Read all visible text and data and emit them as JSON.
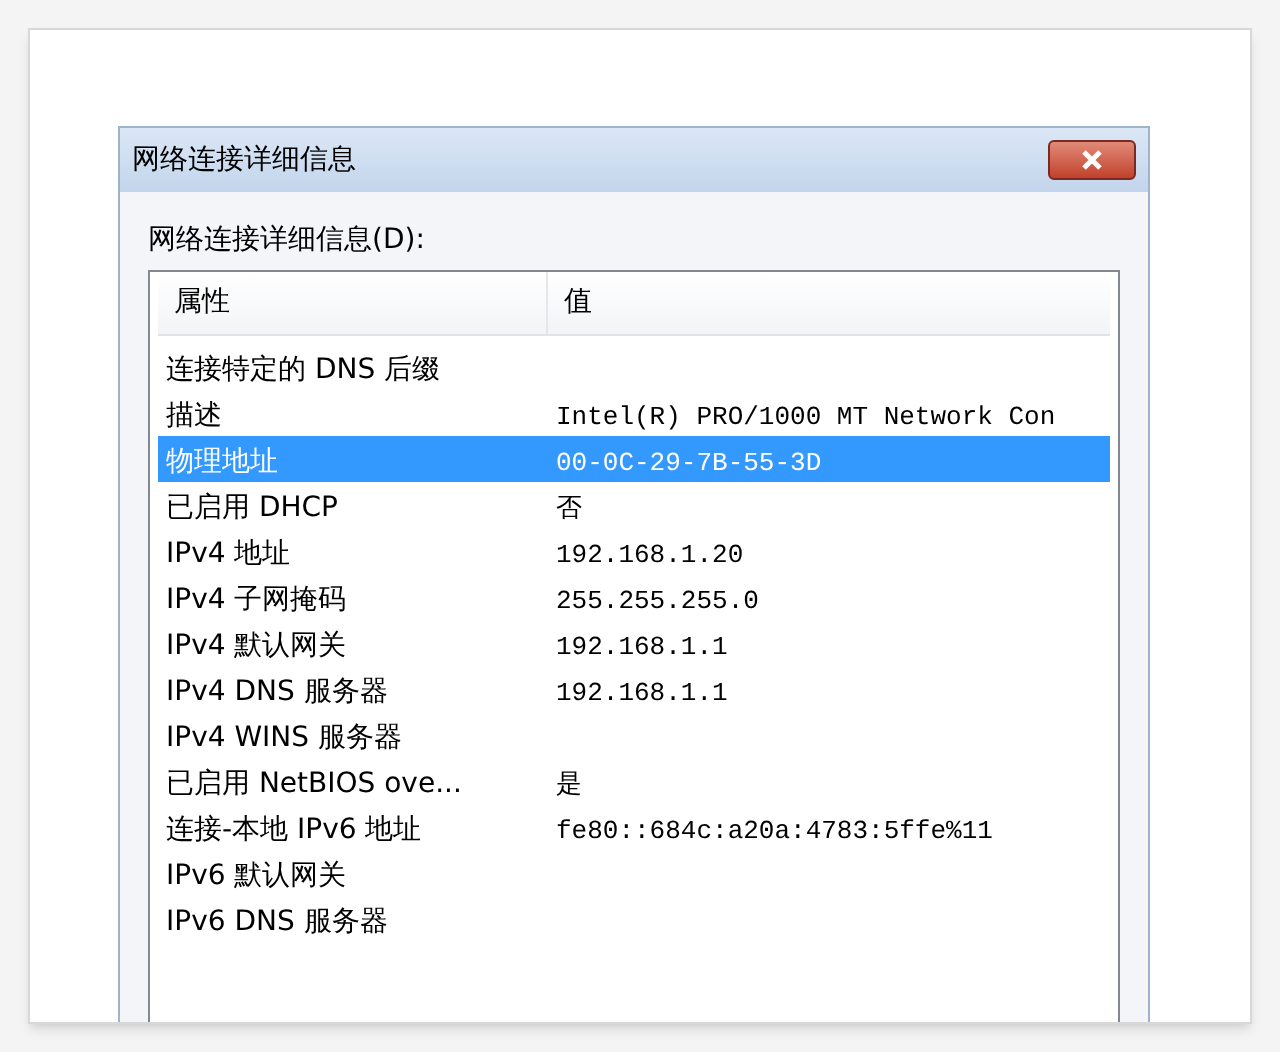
{
  "window": {
    "title": "网络连接详细信息"
  },
  "list_label": "网络连接详细信息(D):",
  "table": {
    "columns": [
      "属性",
      "值"
    ],
    "rows": [
      {
        "property": "连接特定的 DNS 后缀",
        "value": "",
        "selected": false
      },
      {
        "property": "描述",
        "value": "Intel(R) PRO/1000 MT Network Con",
        "selected": false
      },
      {
        "property": "物理地址",
        "value": "00-0C-29-7B-55-3D",
        "selected": true
      },
      {
        "property": "已启用 DHCP",
        "value": "否",
        "selected": false
      },
      {
        "property": "IPv4 地址",
        "value": "192.168.1.20",
        "selected": false
      },
      {
        "property": "IPv4 子网掩码",
        "value": "255.255.255.0",
        "selected": false
      },
      {
        "property": "IPv4 默认网关",
        "value": "192.168.1.1",
        "selected": false
      },
      {
        "property": "IPv4 DNS 服务器",
        "value": "192.168.1.1",
        "selected": false
      },
      {
        "property": "IPv4 WINS 服务器",
        "value": "",
        "selected": false
      },
      {
        "property": "已启用 NetBIOS ove...",
        "value": "是",
        "selected": false
      },
      {
        "property": "连接-本地 IPv6 地址",
        "value": "fe80::684c:a20a:4783:5ffe%11",
        "selected": false
      },
      {
        "property": "IPv6 默认网关",
        "value": "",
        "selected": false
      },
      {
        "property": "IPv6 DNS 服务器",
        "value": "",
        "selected": false
      }
    ]
  }
}
